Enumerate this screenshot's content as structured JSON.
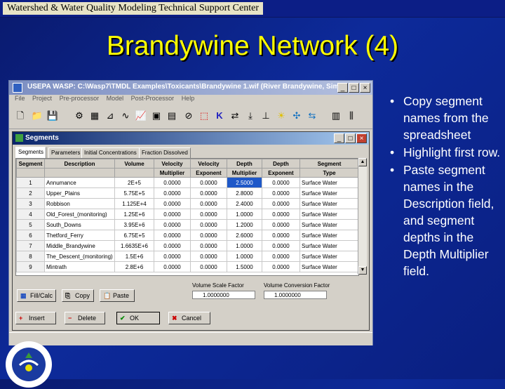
{
  "topbar": {
    "title": "Watershed & Water Quality Modeling Technical Support Center"
  },
  "slide": {
    "title": "Brandywine Network (4)"
  },
  "wasp": {
    "title": "USEPA WASP: C:\\Wasp7\\TMDL Examples\\Toxicants\\Brandywine 1.wif (River Brandywine, Sim...",
    "menu": [
      "File",
      "Project",
      "Pre-processor",
      "Model",
      "Post-Processor",
      "Help"
    ]
  },
  "segments_dialog": {
    "title": "Segments",
    "tabs": [
      "Segments",
      "Parameters",
      "Initial Concentrations",
      "Fraction Dissolved"
    ],
    "columns": [
      {
        "top": "Segment",
        "bottom": ""
      },
      {
        "top": "Description",
        "bottom": ""
      },
      {
        "top": "Volume",
        "bottom": ""
      },
      {
        "top": "Velocity",
        "bottom": "Multiplier"
      },
      {
        "top": "Velocity",
        "bottom": "Exponent"
      },
      {
        "top": "Depth",
        "bottom": "Multiplier"
      },
      {
        "top": "Depth",
        "bottom": "Exponent"
      },
      {
        "top": "Segment",
        "bottom": "Type"
      }
    ],
    "rows": [
      [
        "1",
        "Annumance",
        "2E+5",
        "0.0000",
        "0.0000",
        "2.5000",
        "0.0000",
        "Surface Water"
      ],
      [
        "2",
        "Upper_Plains",
        "5.75E+5",
        "0.0000",
        "0.0000",
        "2.8000",
        "0.0000",
        "Surface Water"
      ],
      [
        "3",
        "Robbison",
        "1.125E+4",
        "0.0000",
        "0.0000",
        "2.4000",
        "0.0000",
        "Surface Water"
      ],
      [
        "4",
        "Old_Forest_(monitoring)",
        "1.25E+6",
        "0.0000",
        "0.0000",
        "1.0000",
        "0.0000",
        "Surface Water"
      ],
      [
        "5",
        "South_Downs",
        "3.95E+6",
        "0.0000",
        "0.0000",
        "1.2000",
        "0.0000",
        "Surface Water"
      ],
      [
        "6",
        "Thetford_Ferry",
        "6.75E+5",
        "0.0000",
        "0.0000",
        "2.6000",
        "0.0000",
        "Surface Water"
      ],
      [
        "7",
        "Middle_Brandywine",
        "1.6635E+6",
        "0.0000",
        "0.0000",
        "1.0000",
        "0.0000",
        "Surface Water"
      ],
      [
        "8",
        "The_Descent_(monitoring)",
        "1.5E+6",
        "0.0000",
        "0.0000",
        "1.0000",
        "0.0000",
        "Surface Water"
      ],
      [
        "9",
        "Mintrath",
        "2.8E+6",
        "0.0000",
        "0.0000",
        "1.5000",
        "0.0000",
        "Surface Water"
      ]
    ],
    "volume_scale_label": "Volume Scale Factor",
    "volume_scale_value": "1.0000000",
    "volume_conversion_label": "Volume Conversion Factor",
    "volume_conversion_value": "1.0000000",
    "buttons": {
      "fill_calc": "Fill/Calc",
      "copy": "Copy",
      "paste": "Paste",
      "insert": "Insert",
      "delete": "Delete",
      "ok": "OK",
      "cancel": "Cancel"
    }
  },
  "bullets": [
    "Copy segment names from the spreadsheet",
    "Highlight first row.",
    "Paste segment names in the Description field, and segment depths in the Depth Multiplier field."
  ],
  "colors": {
    "background": "#0d2a9a",
    "title": "#ffff00",
    "selection": "#1e58c8"
  }
}
